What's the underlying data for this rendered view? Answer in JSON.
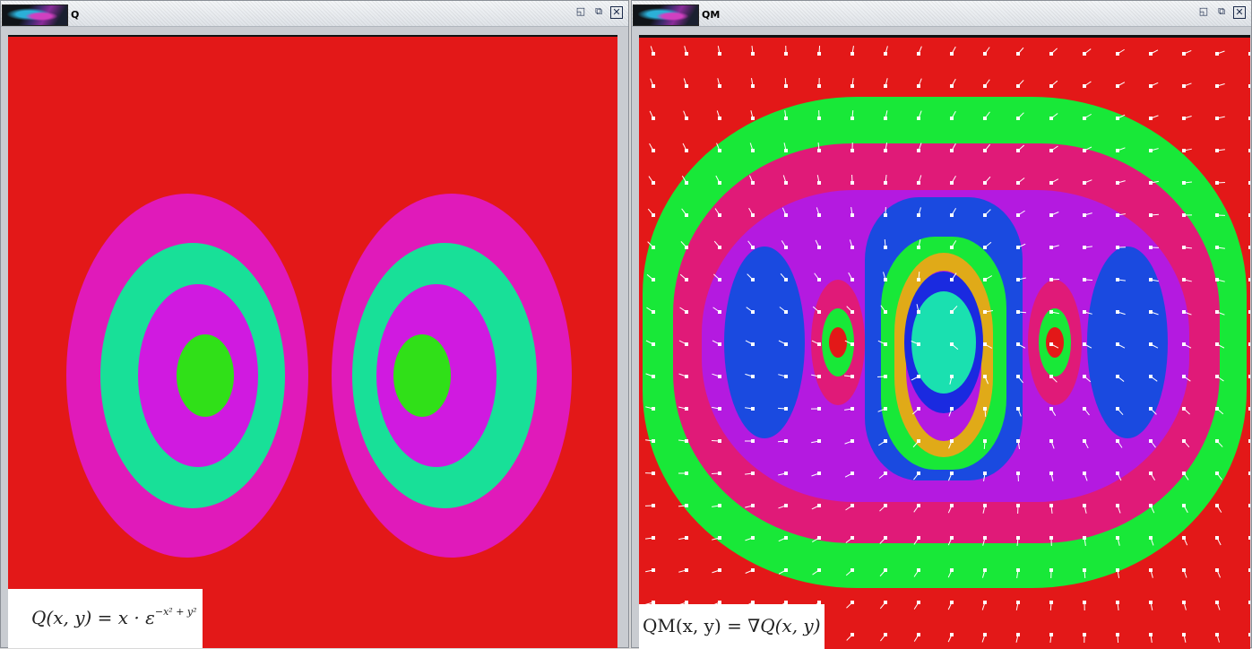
{
  "windows": [
    {
      "title": "Q",
      "formula": {
        "lhs": "Q(x, y)",
        "eq": " = ",
        "rhs": "x · ε",
        "exponent": "−x² + y²"
      }
    },
    {
      "title": "QM",
      "formula": {
        "lhs": "QM(x, y)",
        "eq": " = ",
        "rhs": "∇Q(x, y)"
      }
    }
  ],
  "buttons": {
    "iconify": "◱",
    "maximize": "⧉",
    "close": "✕"
  },
  "colors": {
    "red": "#e31818",
    "magenta": "#e01aba",
    "teal": "#18e098",
    "violet": "#d01ae0",
    "green": "#30e018",
    "bright_green": "#18e838",
    "rose": "#e01a78",
    "purple": "#b41ae0",
    "blue": "#1a4ae0",
    "orange": "#e0aa18",
    "dark_blue": "#1a2ae0",
    "cyan": "#1ae0b0"
  }
}
